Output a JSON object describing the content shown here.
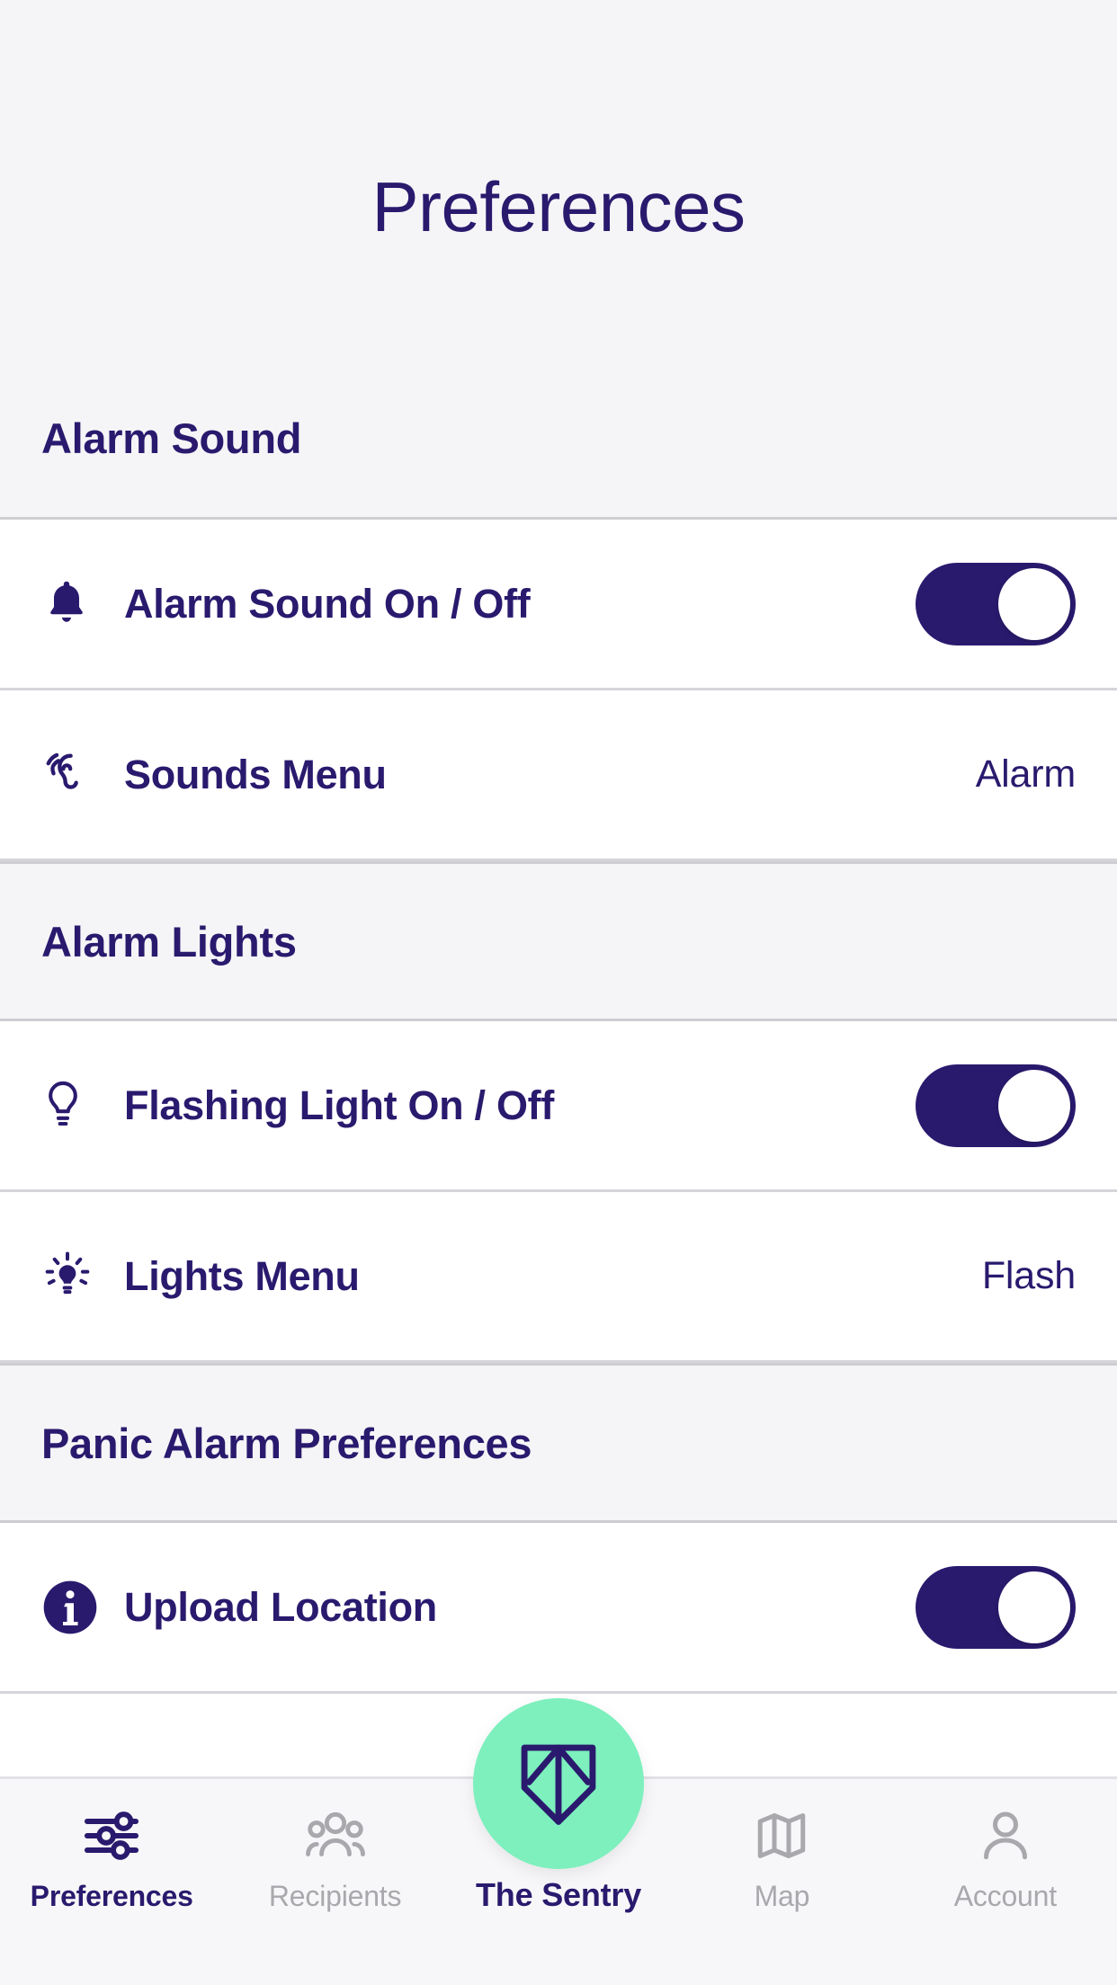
{
  "header": {
    "title": "Preferences"
  },
  "colors": {
    "primary": "#2a1a6e",
    "accent_green": "#7df0bd",
    "inactive_gray": "#a8a8ad",
    "page_bg": "#f5f5f7",
    "row_bg": "#ffffff",
    "divider": "#d5d5da"
  },
  "sections": [
    {
      "title": "Alarm Sound",
      "rows": [
        {
          "icon": "bell-icon",
          "label": "Alarm Sound On / Off",
          "control": "toggle",
          "toggle_state": "on",
          "value": ""
        },
        {
          "icon": "ear-hearing-icon",
          "label": "Sounds Menu",
          "control": "value",
          "toggle_state": "",
          "value": "Alarm"
        }
      ]
    },
    {
      "title": "Alarm Lights",
      "rows": [
        {
          "icon": "lightbulb-icon",
          "label": "Flashing Light On / Off",
          "control": "toggle",
          "toggle_state": "on",
          "value": ""
        },
        {
          "icon": "lightbulb-shining-icon",
          "label": "Lights Menu",
          "control": "value",
          "toggle_state": "",
          "value": "Flash"
        }
      ]
    },
    {
      "title": "Panic Alarm Preferences",
      "rows": [
        {
          "icon": "info-circle-icon",
          "label": "Upload Location",
          "control": "toggle",
          "toggle_state": "on",
          "value": ""
        }
      ]
    }
  ],
  "tabbar": {
    "items": [
      {
        "label": "Preferences",
        "icon": "sliders-icon",
        "active": true
      },
      {
        "label": "Recipients",
        "icon": "people-group-icon",
        "active": false
      },
      {
        "label": "The Sentry",
        "icon": "shield-logo-icon",
        "active": true
      },
      {
        "label": "Map",
        "icon": "map-folded-icon",
        "active": false
      },
      {
        "label": "Account",
        "icon": "person-icon",
        "active": false
      }
    ]
  }
}
